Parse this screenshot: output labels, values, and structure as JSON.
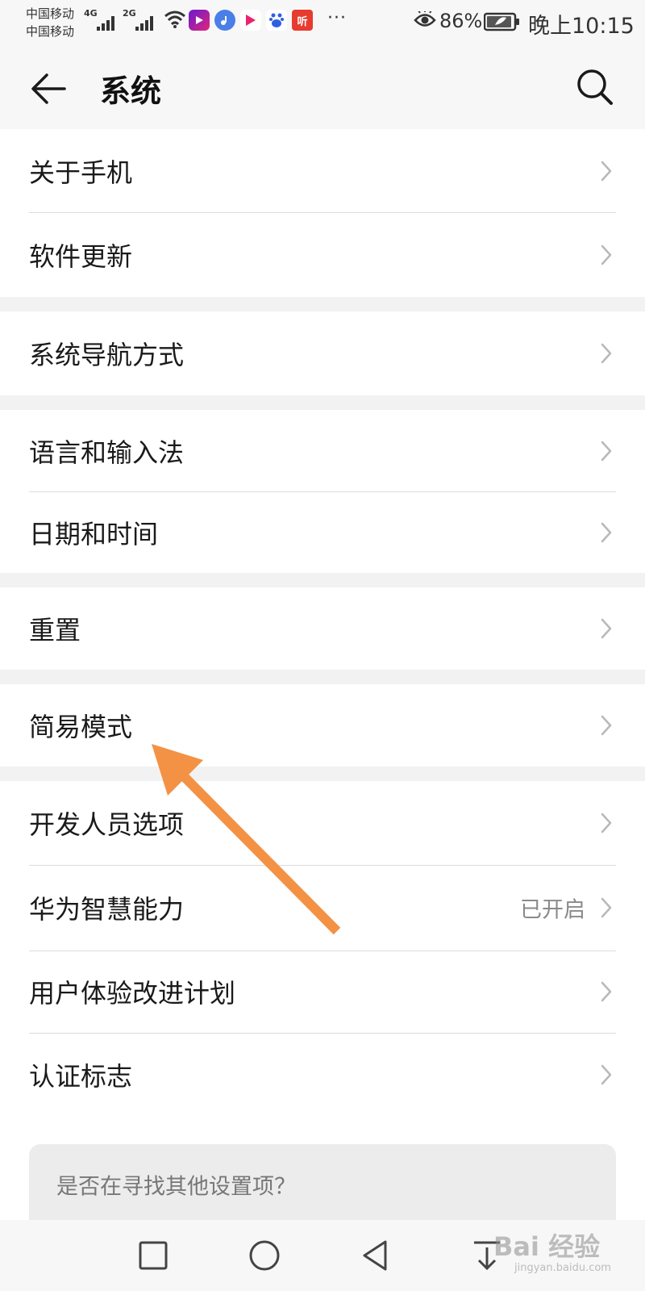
{
  "status_bar": {
    "carrier_1": "中国移动",
    "carrier_2": "中国移动",
    "network_1": "4G",
    "network_2": "2G",
    "app_icons": [
      "video-app-icon",
      "music-app-icon",
      "streaming-app-icon",
      "baidu-app-icon",
      "ting-app-icon"
    ],
    "ting_icon_text": "听",
    "more_indicator": "···",
    "battery_percent": "86%",
    "time": "晚上10:15"
  },
  "header": {
    "title": "系统",
    "back_icon": "arrow-left-icon",
    "search_icon": "search-icon"
  },
  "settings": {
    "about_phone": "关于手机",
    "software_update": "软件更新",
    "system_navigation": "系统导航方式",
    "language_input": "语言和输入法",
    "date_time": "日期和时间",
    "reset": "重置",
    "simple_mode": "简易模式",
    "developer_options": "开发人员选项",
    "huawei_smart": "华为智慧能力",
    "huawei_smart_value": "已开启",
    "user_experience": "用户体验改进计划",
    "certification": "认证标志"
  },
  "suggestion": {
    "text": "是否在寻找其他设置项？"
  },
  "nav_bar": {
    "icons": [
      "square-recents-icon",
      "circle-home-icon",
      "triangle-back-icon",
      "download-icon"
    ]
  },
  "watermark": {
    "main": "Bai 经验",
    "sub": "jingyan.baidu.com"
  },
  "colors": {
    "background": "#f2f2f2",
    "card": "#ffffff",
    "accent_arrow": "#f39245",
    "secondary_text": "#8a8a8a"
  }
}
